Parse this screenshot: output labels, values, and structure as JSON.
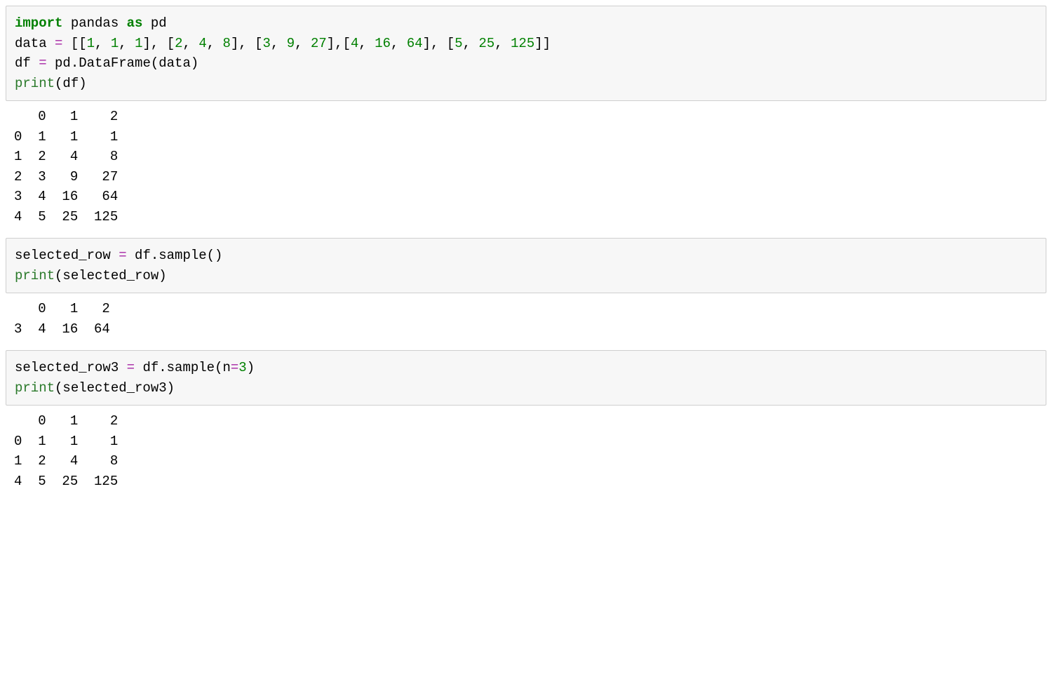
{
  "cell1": {
    "l1_import": "import",
    "l1_pandas": " pandas ",
    "l1_as": "as",
    "l1_pd": " pd",
    "l2": "",
    "l3_pre": "data ",
    "l3_eq": "=",
    "l3_sp": " [[",
    "l3_n1": "1",
    "l3_c1": ", ",
    "l3_n2": "1",
    "l3_c2": ", ",
    "l3_n3": "1",
    "l3_b1": "], [",
    "l3_n4": "2",
    "l3_n5": "4",
    "l3_n6": "8",
    "l3_b2": "], [",
    "l3_n7": "3",
    "l3_n8": "9",
    "l3_n9": "27",
    "l3_b3": "],[",
    "l3_n10": "4",
    "l3_n11": "16",
    "l3_n12": "64",
    "l3_b4": "], [",
    "l3_n13": "5",
    "l3_n14": "25",
    "l3_n15": "125",
    "l3_end": "]]",
    "l4": "",
    "l5_pre": "df ",
    "l5_eq": "=",
    "l5_rest": " pd.DataFrame(data)",
    "l6": "",
    "l7_print": "print",
    "l7_args": "(df)"
  },
  "out1": "   0   1    2\n0  1   1    1\n1  2   4    8\n2  3   9   27\n3  4  16   64\n4  5  25  125",
  "cell2": {
    "l1_pre": "selected_row ",
    "l1_eq": "=",
    "l1_rest": " df.sample()",
    "l2": "",
    "l3_print": "print",
    "l3_args": "(selected_row)"
  },
  "out2": "   0   1   2\n3  4  16  64",
  "cell3": {
    "l1_pre": "selected_row3 ",
    "l1_eq": "=",
    "l1_rest_a": " df.sample(n",
    "l1_eq2": "=",
    "l1_n": "3",
    "l1_rest_b": ")",
    "l2": "",
    "l3_print": "print",
    "l3_args": "(selected_row3)"
  },
  "out3": "   0   1    2\n0  1   1    1\n1  2   4    8\n4  5  25  125"
}
